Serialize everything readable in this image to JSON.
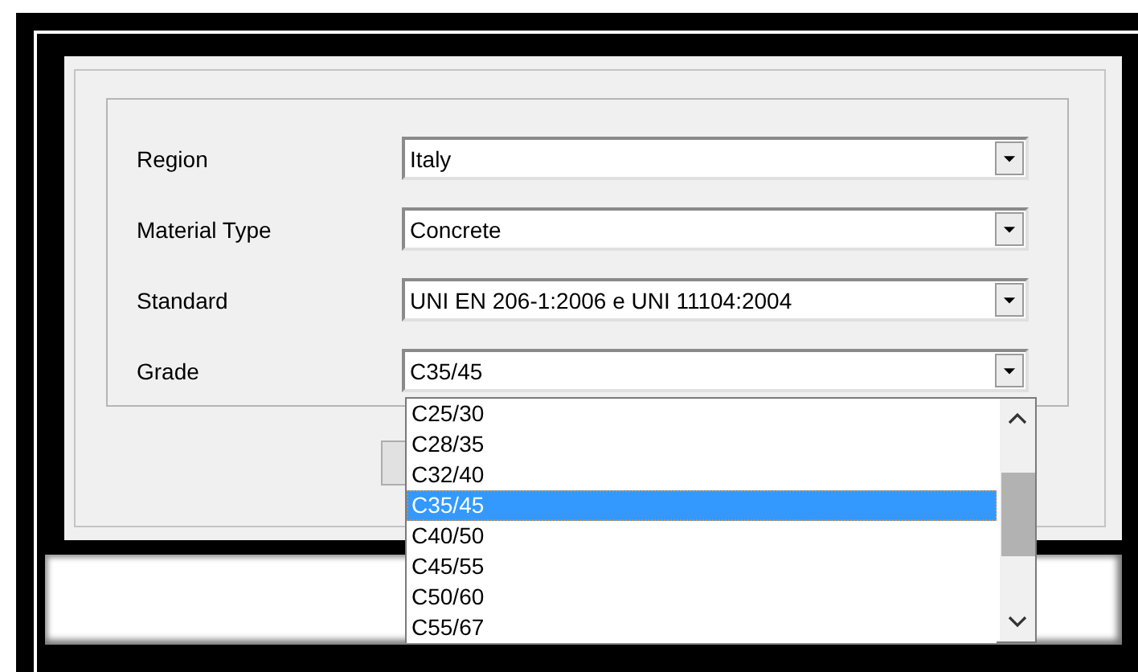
{
  "fields": [
    {
      "label": "Region",
      "value": "Italy"
    },
    {
      "label": "Material Type",
      "value": "Concrete"
    },
    {
      "label": "Standard",
      "value": "UNI EN 206-1:2006 e UNI 11104:2004"
    },
    {
      "label": "Grade",
      "value": "C35/45"
    }
  ],
  "dropdown": {
    "items": [
      {
        "label": "C25/30",
        "selected": false
      },
      {
        "label": "C28/35",
        "selected": false
      },
      {
        "label": "C32/40",
        "selected": false
      },
      {
        "label": "C35/45",
        "selected": true
      },
      {
        "label": "C40/50",
        "selected": false
      },
      {
        "label": "C45/55",
        "selected": false
      },
      {
        "label": "C50/60",
        "selected": false
      },
      {
        "label": "C55/67",
        "selected": false
      }
    ]
  }
}
